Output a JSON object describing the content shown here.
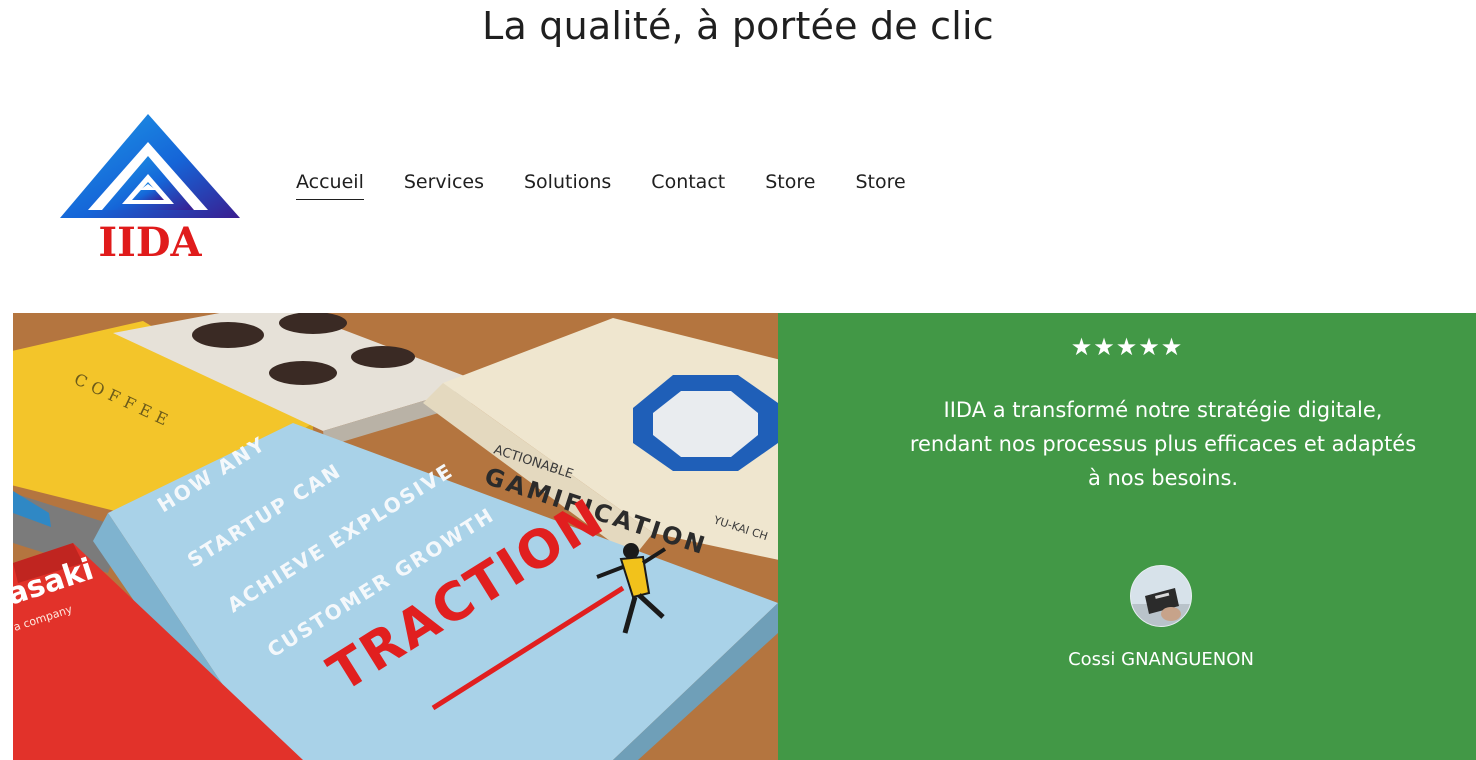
{
  "header": {
    "tagline": "La qualité, à portée de clic",
    "logo_text": "IIDA"
  },
  "nav": {
    "items": [
      {
        "label": "Accueil",
        "active": true
      },
      {
        "label": "Services",
        "active": false
      },
      {
        "label": "Solutions",
        "active": false
      },
      {
        "label": "Contact",
        "active": false
      },
      {
        "label": "Store",
        "active": false
      },
      {
        "label": "Store",
        "active": false
      }
    ]
  },
  "hero": {
    "image_subject": "books on a wooden table",
    "book_titles": [
      "TRACTION",
      "HOW ANY STARTUP CAN ACHIEVE EXPLOSIVE CUSTOMER GROWTH",
      "ACTIONABLE GAMIFICATION",
      "YU-KAI CH",
      "asaki"
    ]
  },
  "testimonial": {
    "stars": "★★★★★",
    "rating": 5,
    "quote": "IIDA a transformé notre stratégie digitale, rendant nos processus plus efficaces et adaptés à nos besoins.",
    "author": "Cossi GNANGUENON",
    "background_color": "#429846"
  },
  "colors": {
    "logo_blue": "#1565d8",
    "logo_purple": "#3a1d8f",
    "logo_red": "#e01b1b"
  }
}
